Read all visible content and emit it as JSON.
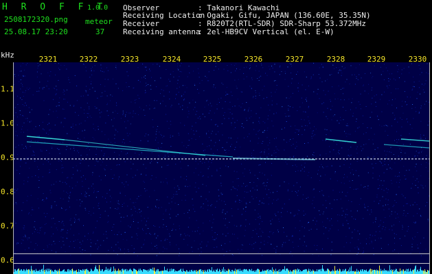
{
  "app": {
    "name": "H R O F F T",
    "version": "1.0.0"
  },
  "file": {
    "name": "2508172320.png",
    "datetime": "25.08.17 23:20"
  },
  "meteor": {
    "label": "meteor",
    "count": "37"
  },
  "info": [
    {
      "label": "Observer",
      "value": ": Takanori Kawachi"
    },
    {
      "label": "Receiving Location",
      "value": ": Ogaki, Gifu, JAPAN (136.60E, 35.35N)"
    },
    {
      "label": "Receiver",
      "value": ": R820T2(RTL-SDR) SDR-Sharp 53.372MHz"
    },
    {
      "label": "Receiving antenna",
      "value": ": 2el-HB9CV Vertical (el. E-W)"
    }
  ],
  "axis": {
    "y_unit": "kHz",
    "x_ticks": [
      "2321",
      "2322",
      "2323",
      "2324",
      "2325",
      "2326",
      "2327",
      "2328",
      "2329",
      "2330"
    ],
    "y_ticks": [
      "1.1",
      "1.0",
      "0.9",
      "0.8",
      "0.7",
      "0.6"
    ]
  },
  "colors": {
    "background": "#000046",
    "carrier": "#e8f4ff",
    "meteor": "#3cf0e6",
    "noise_bar": "#38dcff"
  }
}
